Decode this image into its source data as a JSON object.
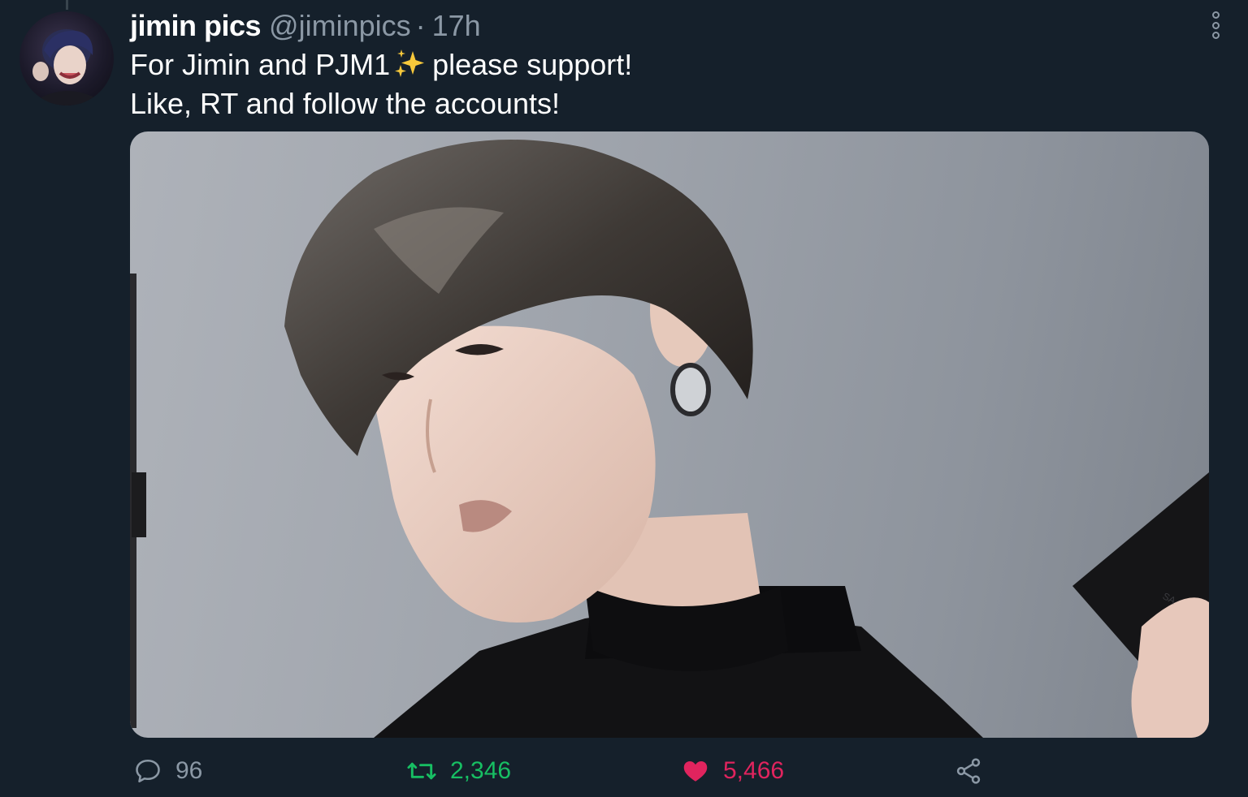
{
  "author": {
    "display_name": "jimin pics",
    "handle": "@jiminpics",
    "separator": "·",
    "time": "17h"
  },
  "tweet": {
    "line1_before": "For Jimin and PJM1",
    "line1_emoji": "sparkles",
    "line1_after": "please support!",
    "line2": "Like, RT and follow the accounts!"
  },
  "media": {
    "description_free": true,
    "phone_brand_partial": "SA"
  },
  "actions": {
    "reply_count": "96",
    "retweet_count": "2,346",
    "like_count": "5,466",
    "liked": true
  },
  "colors": {
    "background": "#15202b",
    "primary_text": "#ffffff",
    "secondary_text": "#8b98a5",
    "retweet": "#17bf63",
    "like": "#e0245e"
  },
  "icons": [
    "more-icon",
    "sparkles-icon",
    "reply-icon",
    "retweet-icon",
    "heart-icon",
    "share-icon"
  ]
}
